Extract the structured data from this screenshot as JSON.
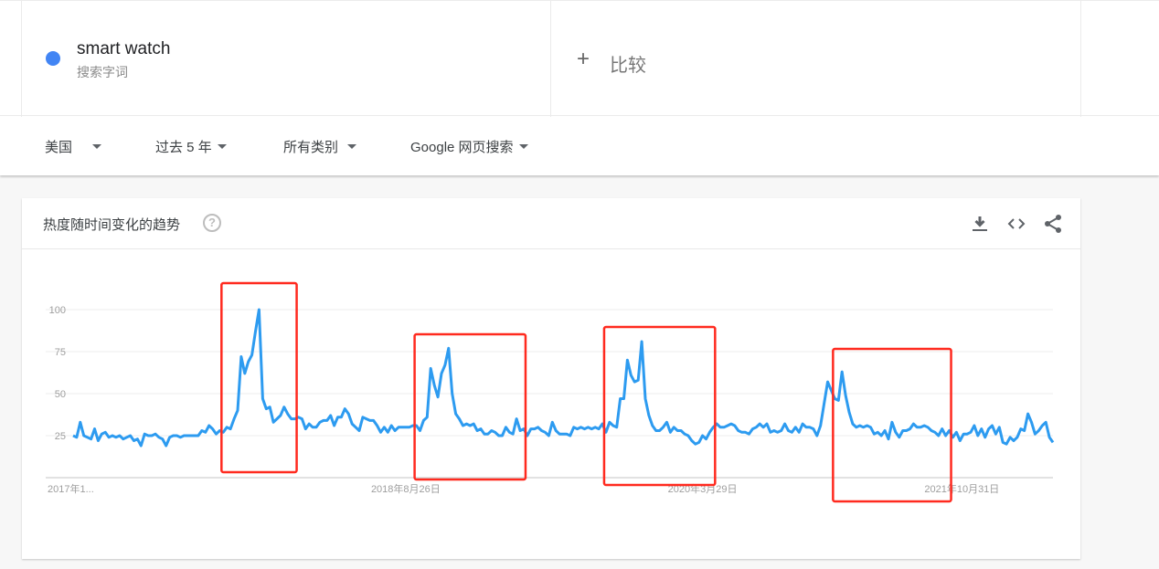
{
  "header": {
    "term": {
      "name": "smart watch",
      "subtitle": "搜索字词",
      "color": "#4285f4"
    },
    "compare": {
      "icon": "plus-icon",
      "label": "比较"
    }
  },
  "filters": [
    {
      "label": "美国"
    },
    {
      "label": "过去 5 年"
    },
    {
      "label": "所有类别"
    },
    {
      "label": "Google 网页搜索"
    }
  ],
  "card": {
    "title": "热度随时间变化的趋势",
    "help_icon": "help-icon",
    "actions": [
      "download-icon",
      "embed-code-icon",
      "share-icon"
    ]
  },
  "annotation_color": "#ff2a1f",
  "chart_data": {
    "type": "line",
    "title": "热度随时间变化的趋势",
    "xlabel": "",
    "ylabel": "",
    "ylim": [
      0,
      100
    ],
    "yticks": [
      25,
      50,
      75,
      100
    ],
    "grid": true,
    "line_color": "#2d9bf0",
    "x_tick_labels": [
      {
        "label": "2017年1...",
        "index": 0
      },
      {
        "label": "2018年8月26日",
        "index": 93
      },
      {
        "label": "2020年3月29日",
        "index": 176
      },
      {
        "label": "2021年10月31日",
        "index": 259
      }
    ],
    "series": [
      {
        "name": "smart watch",
        "values": [
          25,
          24,
          33,
          25,
          24,
          23,
          29,
          22,
          26,
          27,
          24,
          25,
          24,
          25,
          23,
          24,
          25,
          22,
          23,
          19,
          26,
          25,
          25,
          26,
          24,
          23,
          19,
          24,
          25,
          25,
          24,
          25,
          25,
          25,
          25,
          25,
          28,
          27,
          31,
          29,
          26,
          28,
          27,
          30,
          29,
          35,
          40,
          72,
          62,
          69,
          73,
          87,
          100,
          47,
          41,
          42,
          33,
          35,
          37,
          42,
          38,
          35,
          35,
          36,
          35,
          29,
          32,
          30,
          30,
          33,
          34,
          34,
          37,
          31,
          36,
          36,
          41,
          38,
          32,
          30,
          28,
          36,
          35,
          34,
          34,
          31,
          27,
          30,
          27,
          31,
          28,
          30,
          30,
          30,
          30,
          31,
          31,
          28,
          34,
          36,
          65,
          55,
          48,
          62,
          67,
          77,
          50,
          38,
          35,
          31,
          32,
          31,
          32,
          28,
          29,
          26,
          26,
          28,
          27,
          25,
          25,
          30,
          27,
          26,
          35,
          28,
          29,
          25,
          29,
          29,
          30,
          28,
          27,
          25,
          33,
          28,
          26,
          26,
          26,
          25,
          30,
          29,
          30,
          29,
          30,
          29,
          30,
          29,
          32,
          27,
          33,
          31,
          30,
          47,
          47,
          70,
          61,
          57,
          58,
          81,
          47,
          37,
          31,
          28,
          28,
          30,
          33,
          27,
          30,
          28,
          28,
          26,
          25,
          22,
          20,
          21,
          25,
          23,
          27,
          30,
          32,
          30,
          30,
          31,
          32,
          31,
          28,
          27,
          27,
          26,
          29,
          30,
          32,
          30,
          32,
          27,
          28,
          27,
          28,
          32,
          28,
          27,
          30,
          27,
          32,
          30,
          30,
          29,
          25,
          31,
          44,
          57,
          52,
          47,
          46,
          63,
          49,
          39,
          32,
          30,
          31,
          30,
          31,
          30,
          26,
          27,
          25,
          28,
          23,
          33,
          27,
          24,
          28,
          28,
          29,
          32,
          30,
          30,
          31,
          30,
          28,
          27,
          25,
          29,
          25,
          28,
          24,
          27,
          22,
          26,
          26,
          27,
          31,
          25,
          29,
          24,
          29,
          31,
          26,
          30,
          21,
          20,
          24,
          22,
          24,
          29,
          28,
          38,
          33,
          26,
          28,
          31,
          33,
          24,
          21
        ]
      }
    ],
    "annotations": [
      {
        "type": "highlight-box",
        "from_index": 42,
        "to_index": 62
      },
      {
        "type": "highlight-box",
        "from_index": 96,
        "to_index": 126
      },
      {
        "type": "highlight-box",
        "from_index": 149,
        "to_index": 179
      },
      {
        "type": "highlight-box",
        "from_index": 213,
        "to_index": 245
      }
    ]
  }
}
